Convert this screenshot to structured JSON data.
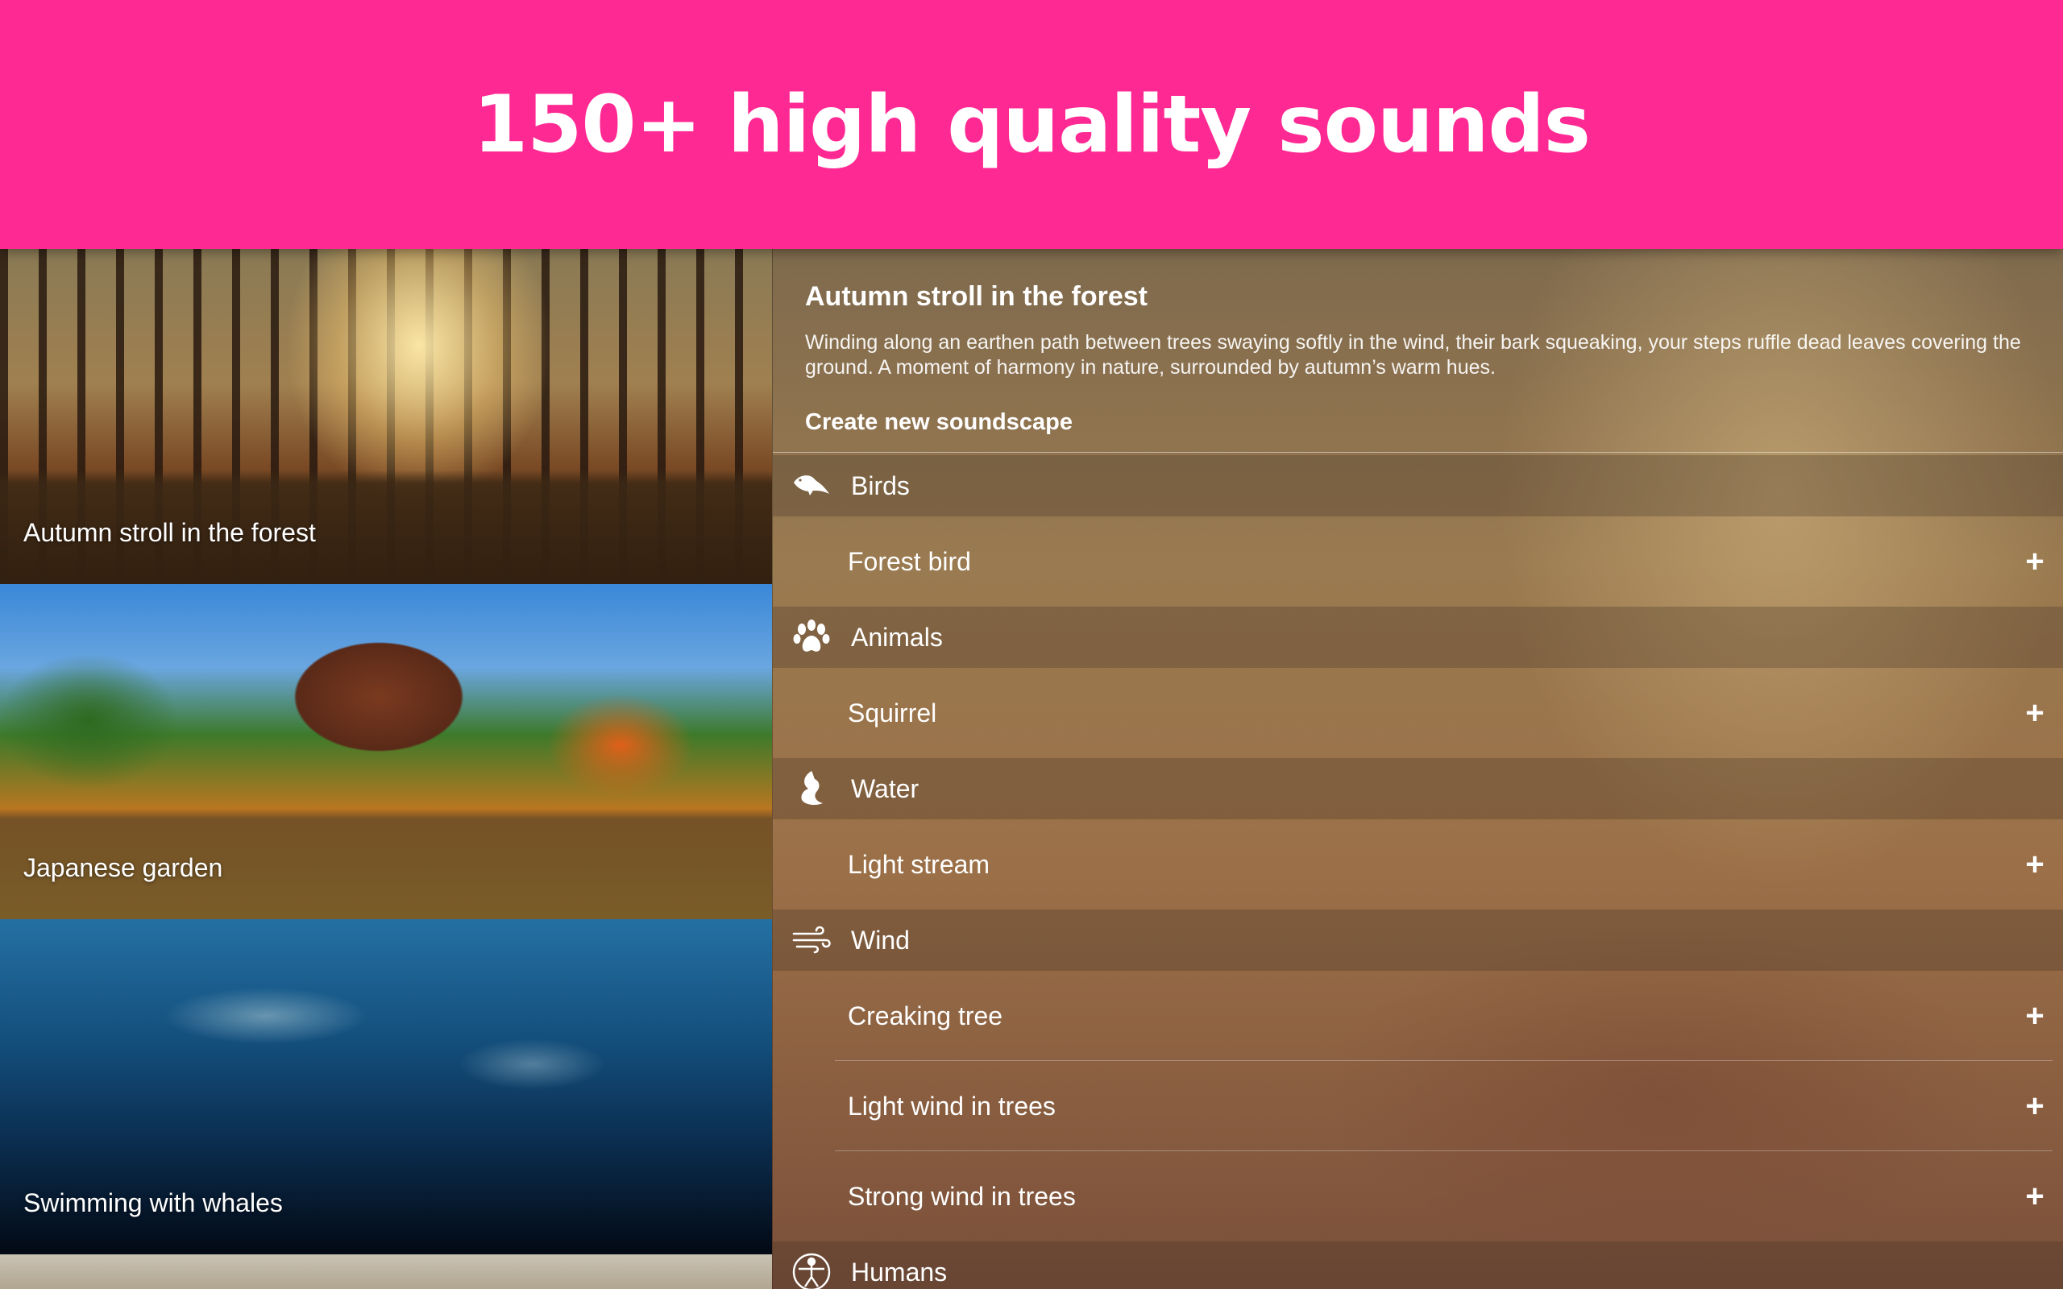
{
  "banner": {
    "headline": "150+ high quality sounds"
  },
  "soundscapes": [
    {
      "title": "Autumn stroll in the forest",
      "selected": true
    },
    {
      "title": "Japanese garden",
      "selected": false
    },
    {
      "title": "Swimming with whales",
      "selected": false
    }
  ],
  "detail": {
    "title": "Autumn stroll in the forest",
    "description": "Winding along an earthen path between trees swaying softly in the wind, their bark squeaking, your steps ruffle dead leaves covering the ground. A moment of harmony in nature, surrounded by autumn’s warm hues.",
    "create_label": "Create new soundscape"
  },
  "categories": [
    {
      "label": "Birds",
      "icon": "bird-icon",
      "sounds": [
        "Forest bird"
      ]
    },
    {
      "label": "Animals",
      "icon": "paw-icon",
      "sounds": [
        "Squirrel"
      ]
    },
    {
      "label": "Water",
      "icon": "water-wave-icon",
      "sounds": [
        "Light stream"
      ]
    },
    {
      "label": "Wind",
      "icon": "wind-icon",
      "sounds": [
        "Creaking tree",
        "Light wind in trees",
        "Strong wind in trees"
      ]
    },
    {
      "label": "Humans",
      "icon": "human-figure-icon",
      "sounds": []
    }
  ],
  "add_symbol": "+",
  "colors": {
    "banner": "#ff2993"
  }
}
